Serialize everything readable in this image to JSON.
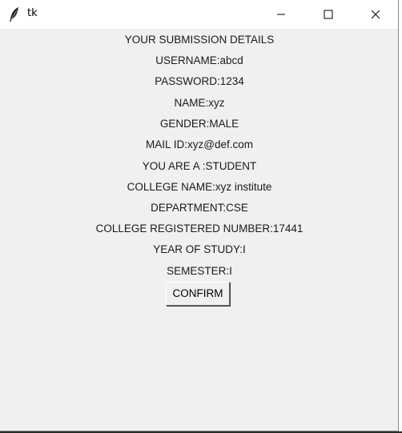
{
  "window": {
    "title": "tk",
    "controls": {
      "minimize": "minimize",
      "maximize": "maximize",
      "close": "close"
    }
  },
  "details": {
    "heading": "YOUR SUBMISSION DETAILS",
    "username": "USERNAME:abcd",
    "password": "PASSWORD:1234",
    "name": "NAME:xyz",
    "gender": "GENDER:MALE",
    "mail_id": "MAIL ID:xyz@def.com",
    "role": "YOU ARE A :STUDENT",
    "college_name": "COLLEGE NAME:xyz institute",
    "department": "DEPARTMENT:CSE",
    "registered_number": "COLLEGE REGISTERED NUMBER:17441",
    "year_of_study": "YEAR OF STUDY:I",
    "semester": "SEMESTER:I"
  },
  "confirm_button": {
    "label": "CONFIRM"
  },
  "icons": {
    "app": "feather-icon",
    "minimize": "minimize-icon",
    "maximize": "maximize-icon",
    "close": "close-icon"
  }
}
